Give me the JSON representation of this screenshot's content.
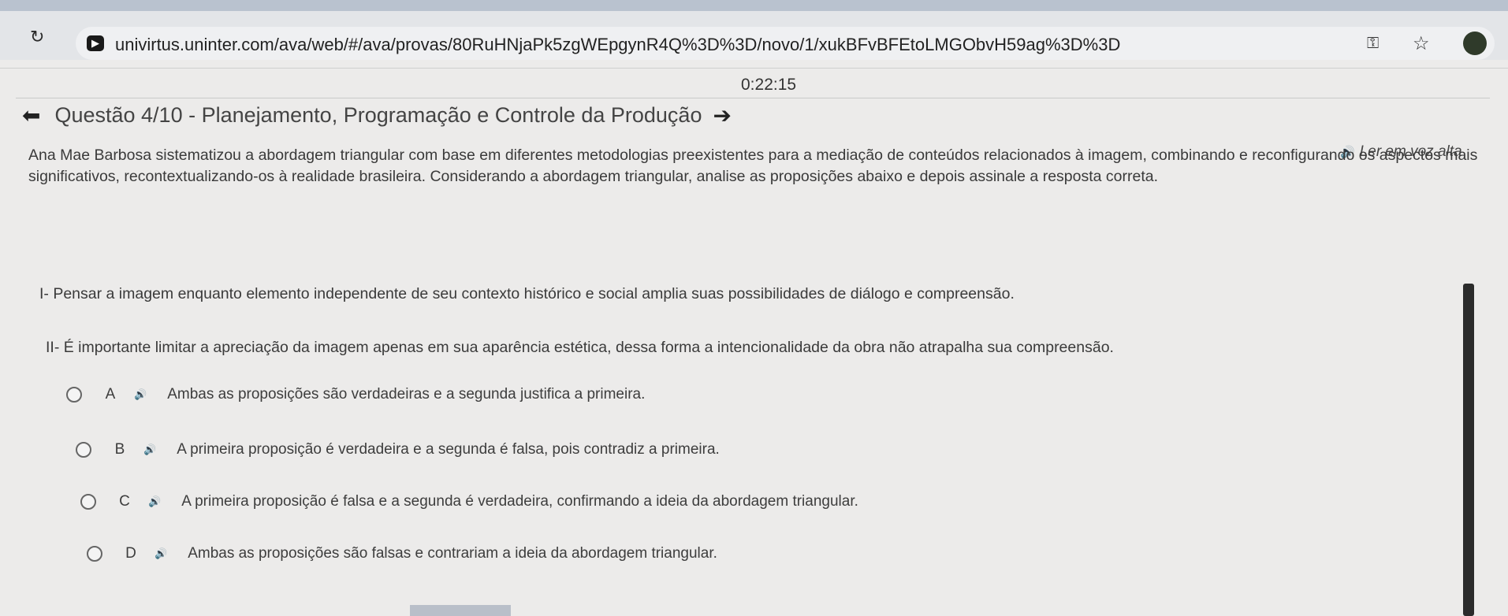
{
  "browser": {
    "url": "univirtus.uninter.com/ava/web/#/ava/provas/80RuHNjaPk5zgWEpgynR4Q%3D%3D/novo/1/xukBFvBFEtoLMGObvH59ag%3D%3D",
    "icons": [
      "reload-icon",
      "site-icon",
      "key-icon",
      "star-icon",
      "avatar"
    ]
  },
  "page": {
    "timer": "0:22:15",
    "question_header": "Questão 4/10 - Planejamento, Programação e Controle da Produção",
    "read_aloud_label": "Ler em voz alta",
    "statement": "Ana Mae Barbosa sistematizou a abordagem triangular com base em diferentes metodologias preexistentes para a mediação de conteúdos relacionados à imagem, combinando e reconfigurando os aspectos mais significativos, recontextualizando-os à realidade brasileira. Considerando a abordagem triangular, analise as proposições abaixo e depois assinale a resposta correta.",
    "proposition_1": "I- Pensar a imagem enquanto elemento independente de seu contexto histórico e social amplia suas possibilidades de diálogo e compreensão.",
    "proposition_2": "II- É importante limitar a apreciação da imagem apenas em sua aparência estética, dessa forma a intencionalidade da obra não atrapalha sua compreensão.",
    "options": [
      {
        "letter": "A",
        "text": "Ambas as proposições são verdadeiras e a segunda justifica a primeira."
      },
      {
        "letter": "B",
        "text": "A primeira proposição é verdadeira e a segunda é falsa, pois contradiz a primeira."
      },
      {
        "letter": "C",
        "text": "A primeira proposição é falsa e a segunda é verdadeira, confirmando a ideia da abordagem triangular."
      },
      {
        "letter": "D",
        "text": "Ambas as proposições são falsas e contrariam a ideia da abordagem triangular."
      }
    ]
  }
}
